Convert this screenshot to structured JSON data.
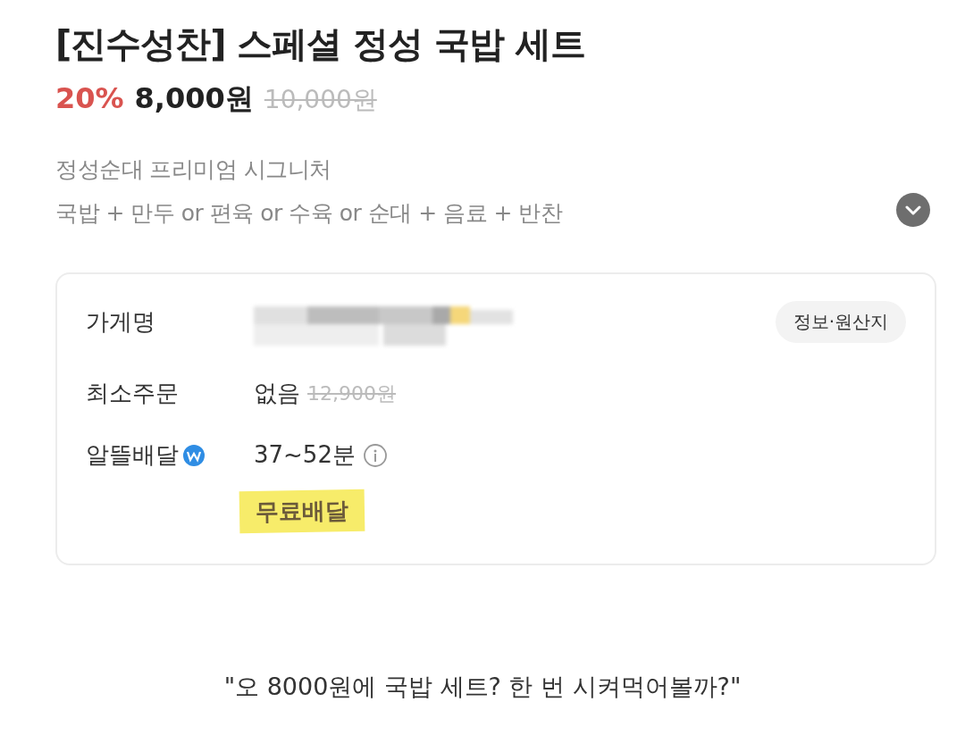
{
  "product": {
    "title": "[진수성찬] 스페셜 정성 국밥 세트",
    "discount": "20%",
    "price": "8,000원",
    "original_price": "10,000원",
    "description": [
      "정성순대 프리미엄 시그니처",
      "국밥 + 만두 or 편육 or 수육 or 순대 + 음료 + 반찬"
    ],
    "expanded": false
  },
  "store_info": {
    "info_button": "정보·원산지",
    "rows": [
      {
        "kind": "store",
        "label": "가게명"
      },
      {
        "kind": "min_order",
        "label": "최소주문",
        "value": "없음",
        "struck_value": "12,900원"
      },
      {
        "kind": "delivery",
        "label": "알뜰배달",
        "value": "37~52분",
        "note": "무료배달",
        "note_highlighted": true
      }
    ]
  },
  "caption": "\"오 8000원에 국밥 세트? 한 번 시켜먹어볼까?\""
}
